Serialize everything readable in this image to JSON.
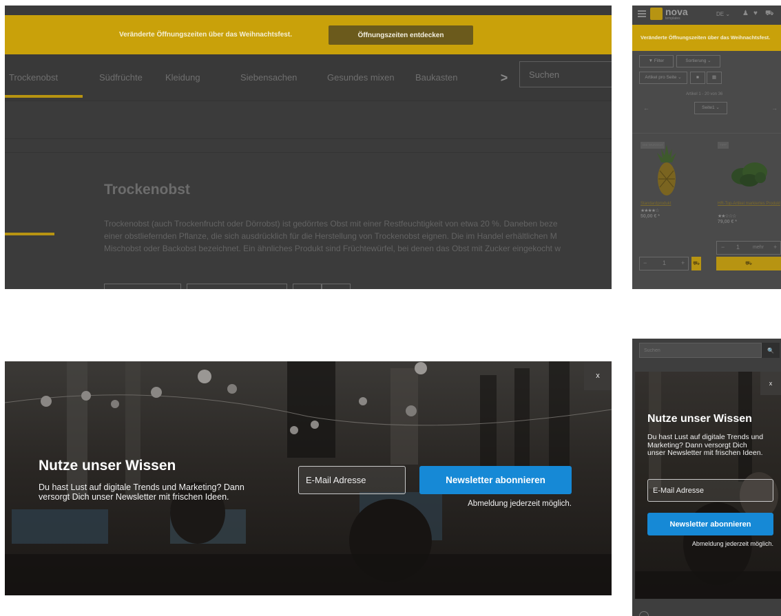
{
  "desktop_shop": {
    "banner": {
      "text": "Veränderte Öffnungszeiten über das Weihnachtsfest.",
      "button_label": "Öffnungszeiten entdecken"
    },
    "nav": {
      "items": [
        {
          "label": "Trockenobst"
        },
        {
          "label": "Südfrüchte"
        },
        {
          "label": "Kleidung"
        },
        {
          "label": "Siebensachen"
        },
        {
          "label": "Gesundes mixen"
        },
        {
          "label": "Baukasten"
        }
      ],
      "active_item": "Trockenobst",
      "more_glyph": ">",
      "search_placeholder": "Suchen"
    },
    "category": {
      "title": "Trockenobst",
      "description_lines": [
        "Trockenobst (auch Trockenfrucht oder Dörrobst) ist gedörrtes Obst mit einer Restfeuchtigkeit von etwa 20 %. Daneben beze",
        "einer obstliefernden Pflanze, die sich ausdrücklich für die Herstellung von Trockenobst eignen. Die im Handel erhältlichen M",
        "Mischobst oder Backobst bezeichnet. Ein ähnliches Produkt sind Früchtewürfel, bei denen das Obst mit Zucker eingekocht w"
      ]
    }
  },
  "mobile_shop": {
    "header": {
      "logo_text": "nova",
      "logo_subtext": "templates",
      "language": "DE ⌄",
      "icons": [
        "user-icon",
        "heart-icon",
        "cart-icon"
      ],
      "icon_glyphs": {
        "user": "♟",
        "heart": "♥",
        "cart": "⛟"
      }
    },
    "banner_text": "Veränderte Öffnungszeiten über das Weihnachtsfest.",
    "filter_label": "Filter",
    "filter_glyph": "▼",
    "sort_label": "Sortierung ⌄",
    "per_page_label": "Artikel pro Seite ⌄",
    "view_glyphs": {
      "list": "■",
      "grid": "▦"
    },
    "count_label": "Artikel 1 - 20 von 36",
    "page_select_label": "Seite1 ⌄",
    "prev_arrow": "←",
    "next_arrow": "→",
    "products": [
      {
        "badge": "DIE WUNSCH",
        "name": "Standardprodukt",
        "stars": "★★★★☆",
        "rating": 4,
        "price": "50,00 € *",
        "quantity": "1",
        "stepper_minus": "−",
        "stepper_plus": "+",
        "cart_glyph": "⛟"
      },
      {
        "badge": "TIPP",
        "name": "HR-Top-Artikel markiertes Produkt",
        "stars": "★★☆☆☆",
        "rating": 2,
        "price": "79,00 € *",
        "quantity": "1",
        "more_label": "mehr",
        "stepper_minus": "−",
        "stepper_plus": "+",
        "cart_glyph": "⛟"
      }
    ]
  },
  "desktop_newsletter": {
    "close_label": "x",
    "title": "Nutze unser Wissen",
    "description_lines": [
      "Du hast Lust auf digitale Trends und Marketing? Dann",
      "versorgt Dich unser Newsletter mit frischen Ideen."
    ],
    "email_placeholder": "E-Mail Adresse",
    "submit_label": "Newsletter abonnieren",
    "note": "Abmeldung jederzeit möglich."
  },
  "mobile_newsletter": {
    "search_placeholder": "Suchen",
    "search_glyph": "🔍",
    "close_label": "x",
    "title": "Nutze unser Wissen",
    "description_lines": [
      "Du hast Lust auf digitale Trends und",
      "Marketing? Dann versorgt Dich",
      "unser Newsletter mit frischen Ideen."
    ],
    "email_placeholder": "E-Mail Adresse",
    "submit_label": "Newsletter abonnieren",
    "note": "Abmeldung jederzeit möglich."
  },
  "colors": {
    "accent_yellow": "#c9a10a",
    "banner_button": "#6b5a1c",
    "newsletter_button_blue": "#1689d6",
    "overlay_dark": "#3b3b3b"
  }
}
